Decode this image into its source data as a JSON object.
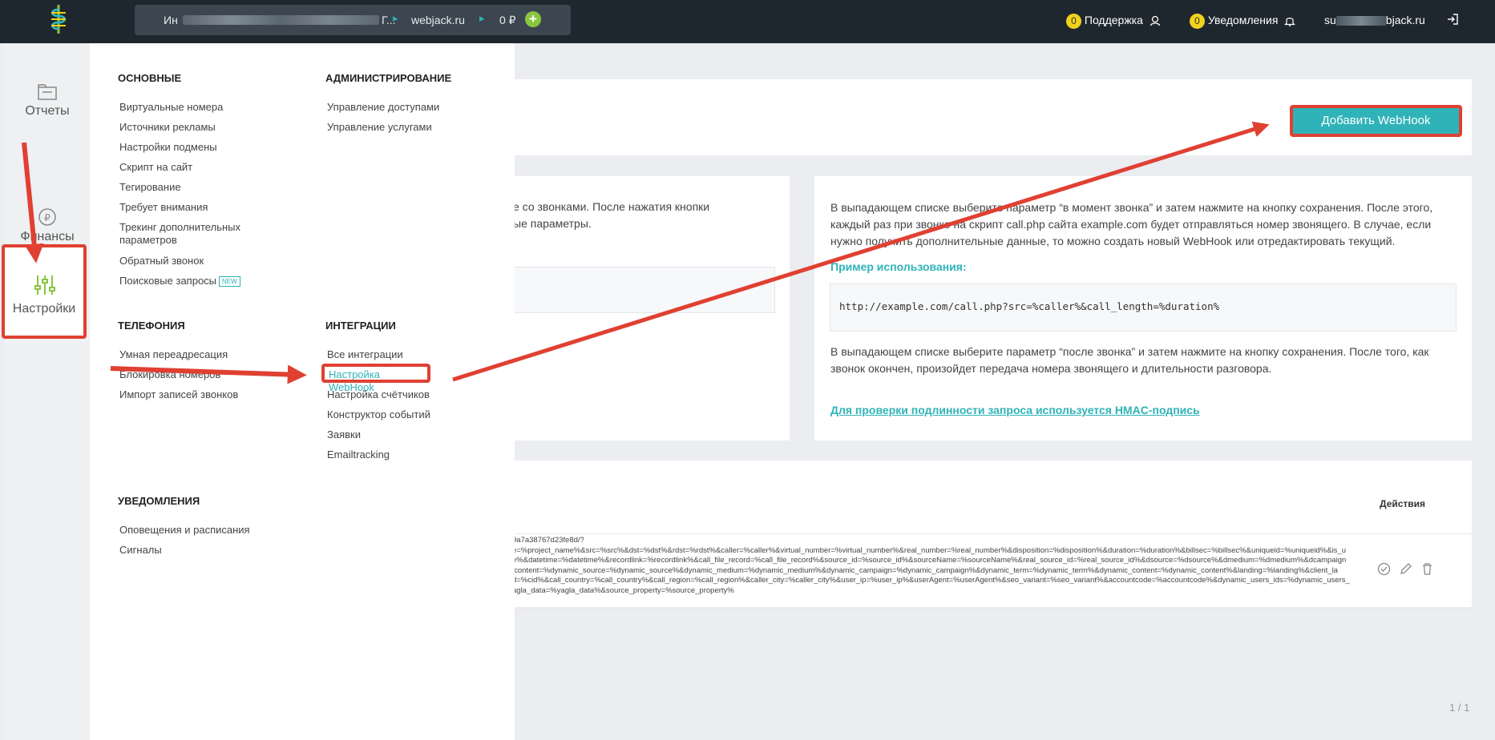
{
  "header": {
    "project_name": "Ин",
    "project_tail": "Г...",
    "site": "webjack.ru",
    "balance": "0 ₽",
    "add_balance": "+",
    "support_count": "0",
    "support_label": "Поддержка",
    "notif_count": "0",
    "notif_label": "Уведомления",
    "user_prefix": "su",
    "user_suffix": "bjack.ru"
  },
  "sidebar": {
    "reports": "Отчеты",
    "finance": "Финансы",
    "settings": "Настройки"
  },
  "menu": {
    "basic": {
      "title": "ОСНОВНЫЕ",
      "items": [
        "Виртуальные номера",
        "Источники рекламы",
        "Настройки подмены",
        "Скрипт на сайт",
        "Тегирование",
        "Требует внимания",
        "Трекинг дополнительных параметров",
        "Обратный звонок",
        "Поисковые запросы"
      ],
      "new_badge": "NEW"
    },
    "admin": {
      "title": "АДМИНИСТРИРОВАНИЕ",
      "items": [
        "Управление доступами",
        "Управление услугами"
      ]
    },
    "telephony": {
      "title": "ТЕЛЕФОНИЯ",
      "items": [
        "Умная переадресация",
        "Блокировка номеров",
        "Импорт записей звонков"
      ]
    },
    "integrations": {
      "title": "ИНТЕГРАЦИИ",
      "items": [
        "Все интеграции",
        "Настройка WebHook",
        "Настройка счётчиков",
        "Конструктор событий",
        "Заявки",
        "Emailtracking"
      ]
    },
    "notifications": {
      "title": "УВЕДОМЛЕНИЯ",
      "items": [
        "Оповещения и расписания",
        "Сигналы"
      ]
    }
  },
  "content": {
    "add_button": "Добавить WebHook",
    "left_text_1": "е со звонками. После нажатия кнопки",
    "left_text_2": "ые параметры.",
    "right_p1": "В выпадающем списке выберите параметр “в момент звонка” и затем нажмите на кнопку сохранения. После этого, каждый раз при звонке на скрипт call.php сайта example.com будет отправляться номер звонящего. В случае, если нужно получить дополнительные данные, то можно создать новый WebHook или отредактировать текущий.",
    "example_title": "Пример использования:",
    "example_code": "http://example.com/call.php?src=%caller%&call_length=%duration%",
    "right_p2": "В выпадающем списке выберите параметр “после звонка” и затем нажмите на кнопку сохранения. После того, как звонок окончен, произойдет передача номера звонящего и длительности разговора.",
    "hmac_link": "Для проверки подлинности запроса используется HMAC-подпись",
    "actions_header": "Действия",
    "url_lines": [
      "9a7a38767d23fe8d/?",
      "e=%project_name%&src=%src%&dst=%dst%&rdst=%rdst%&caller=%caller%&virtual_number=%virtual_number%&real_number=%real_number%&disposition=%disposition%&duration=%duration%&billsec=%billsec%&uniqueid=%uniqueid%&is_u",
      "e%&datetime=%datetime%&recordlink=%recordlink%&call_file_record=%call_file_record%&source_id=%source_id%&sourceName=%sourceName%&real_source_id=%real_source_id%&dsource=%dsource%&dmedium=%dmedium%&dcampaign",
      "lcontent=%dynamic_source=%dynamic_source%&dynamic_medium=%dynamic_medium%&dynamic_campaign=%dynamic_campaign%&dynamic_term=%dynamic_term%&dynamic_content=%dynamic_content%&landing=%landing%&client_la",
      "d=%cid%&call_country=%call_country%&call_region=%call_region%&caller_city=%caller_city%&user_ip=%user_ip%&userAgent=%userAgent%&seo_variant=%seo_variant%&accountcode=%accountcode%&dynamic_users_ids=%dynamic_users_",
      "agla_data=%yagla_data%&source_property=%source_property%"
    ],
    "pagination": "1 / 1"
  },
  "colors": {
    "accent": "#2fb3b8",
    "highlight": "#e04032",
    "topbar": "#1f272e"
  }
}
